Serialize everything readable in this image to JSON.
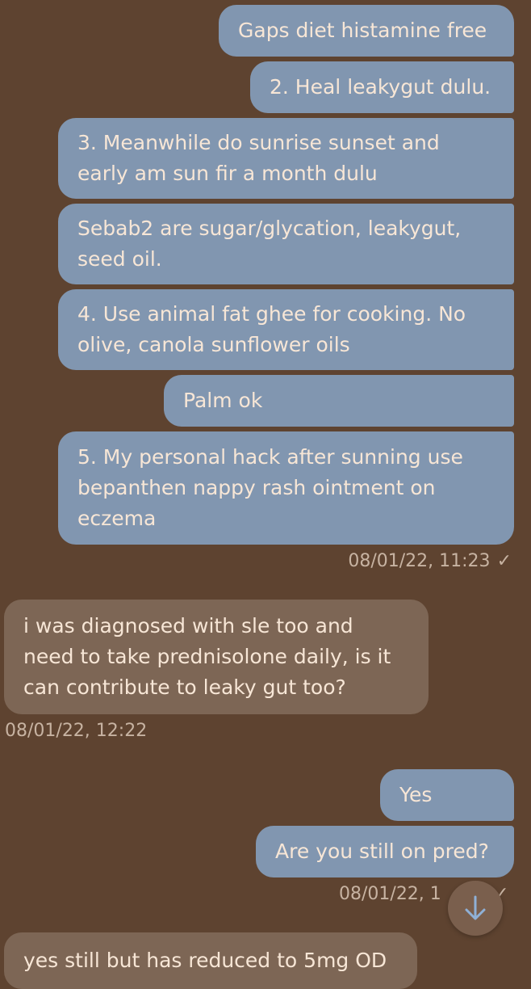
{
  "messages": [
    {
      "text": "Gaps diet histamine free"
    },
    {
      "text": "2. Heal leakygut dulu."
    },
    {
      "text": "3. Meanwhile do sunrise sunset and early am sun fir a month dulu"
    },
    {
      "text": "Sebab2 are sugar/glycation, leakygut, seed oil."
    },
    {
      "text": "4. Use animal fat ghee for cooking. No olive, canola sunflower oils"
    },
    {
      "text": "Palm ok"
    },
    {
      "text": "5. My personal hack after sunning use bepanthen nappy rash ointment on eczema"
    },
    {
      "text": "i was diagnosed with sle too and need to take prednisolone daily, is it can contribute to leaky gut too?"
    },
    {
      "text": "Yes"
    },
    {
      "text": "Are you still on pred?"
    },
    {
      "text": "yes still but has reduced to 5mg OD"
    }
  ],
  "timestamps": {
    "out_1": "08/01/22, 11:23",
    "in_1": "08/01/22, 12:22",
    "out_2": "08/01/22, 1"
  },
  "icons": {
    "read_check": "✓",
    "scroll_down": "arrow-down-icon"
  },
  "colors": {
    "background": "#5e4330",
    "outgoing_bubble": "#8196b0",
    "incoming_bubble": "#7d6655",
    "text": "#f7e6d6",
    "timestamp": "#c7b3a2",
    "scroll_button": "#7a5f4d",
    "scroll_arrow": "#8fb0d6"
  }
}
